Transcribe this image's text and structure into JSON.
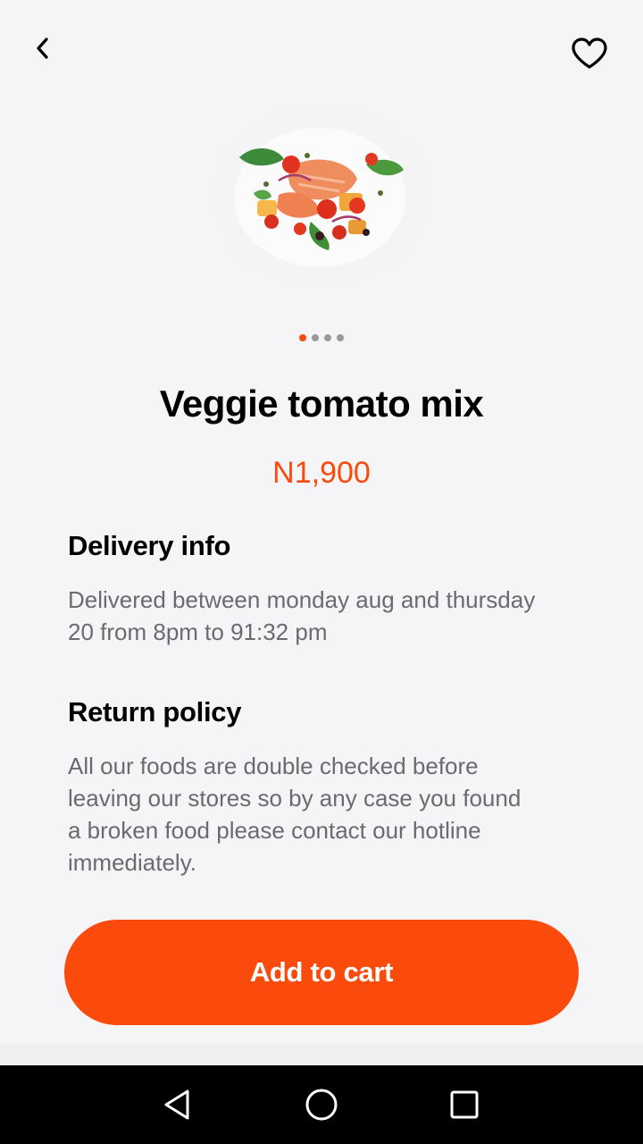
{
  "header": {
    "back_icon": "chevron-left-icon",
    "favorite_icon": "heart-outline-icon"
  },
  "product": {
    "image_alt": "Plate of veggie tomato mix with salmon, tomatoes and basil",
    "name": "Veggie tomato mix",
    "price": "N1,900",
    "carousel": {
      "count": 4,
      "active_index": 0
    }
  },
  "delivery": {
    "title": "Delivery info",
    "body_line1": "Delivered between monday aug and thursday",
    "body_line2": "20 from 8pm to 91:32 pm"
  },
  "returns": {
    "title": "Return policy",
    "body_line1": "All our foods are double checked before",
    "body_line2": "leaving our stores so by any case you found",
    "body_line3": "a broken food please contact our hotline",
    "body_line4": "immediately."
  },
  "cta": {
    "label": "Add to cart"
  },
  "system_nav": {
    "back_icon": "triangle-back-icon",
    "home_icon": "circle-home-icon",
    "recents_icon": "square-recents-icon"
  },
  "colors": {
    "accent": "#fa4a0c",
    "background": "#f5f5f8",
    "body_text": "#6b6b6f",
    "dot_inactive": "#9a9a9d"
  }
}
